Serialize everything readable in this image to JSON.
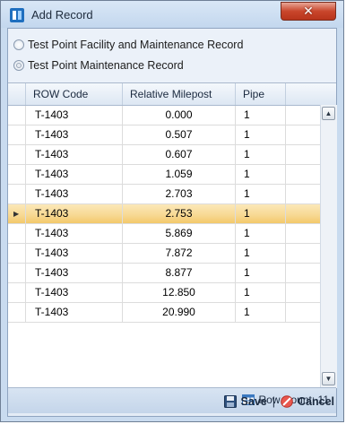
{
  "window": {
    "title": "Add Record"
  },
  "options": [
    {
      "label": "Test Point Facility and Maintenance Record",
      "selected": false
    },
    {
      "label": "Test Point Maintenance Record",
      "selected": true
    }
  ],
  "grid": {
    "columns": [
      "ROW Code",
      "Relative Milepost",
      "Pipe"
    ],
    "rows": [
      [
        "T-1403",
        "0.000",
        "1"
      ],
      [
        "T-1403",
        "0.507",
        "1"
      ],
      [
        "T-1403",
        "0.607",
        "1"
      ],
      [
        "T-1403",
        "1.059",
        "1"
      ],
      [
        "T-1403",
        "2.703",
        "1"
      ],
      [
        "T-1403",
        "2.753",
        "1"
      ],
      [
        "T-1403",
        "5.869",
        "1"
      ],
      [
        "T-1403",
        "7.872",
        "1"
      ],
      [
        "T-1403",
        "8.877",
        "1"
      ],
      [
        "T-1403",
        "12.850",
        "1"
      ],
      [
        "T-1403",
        "20.990",
        "1"
      ]
    ],
    "selected_row_index": 5
  },
  "status": {
    "row_count_label": "Row Count:",
    "row_count": "11"
  },
  "footer": {
    "save_label": "Save",
    "separator": "|",
    "cancel_label": "Cancel"
  }
}
